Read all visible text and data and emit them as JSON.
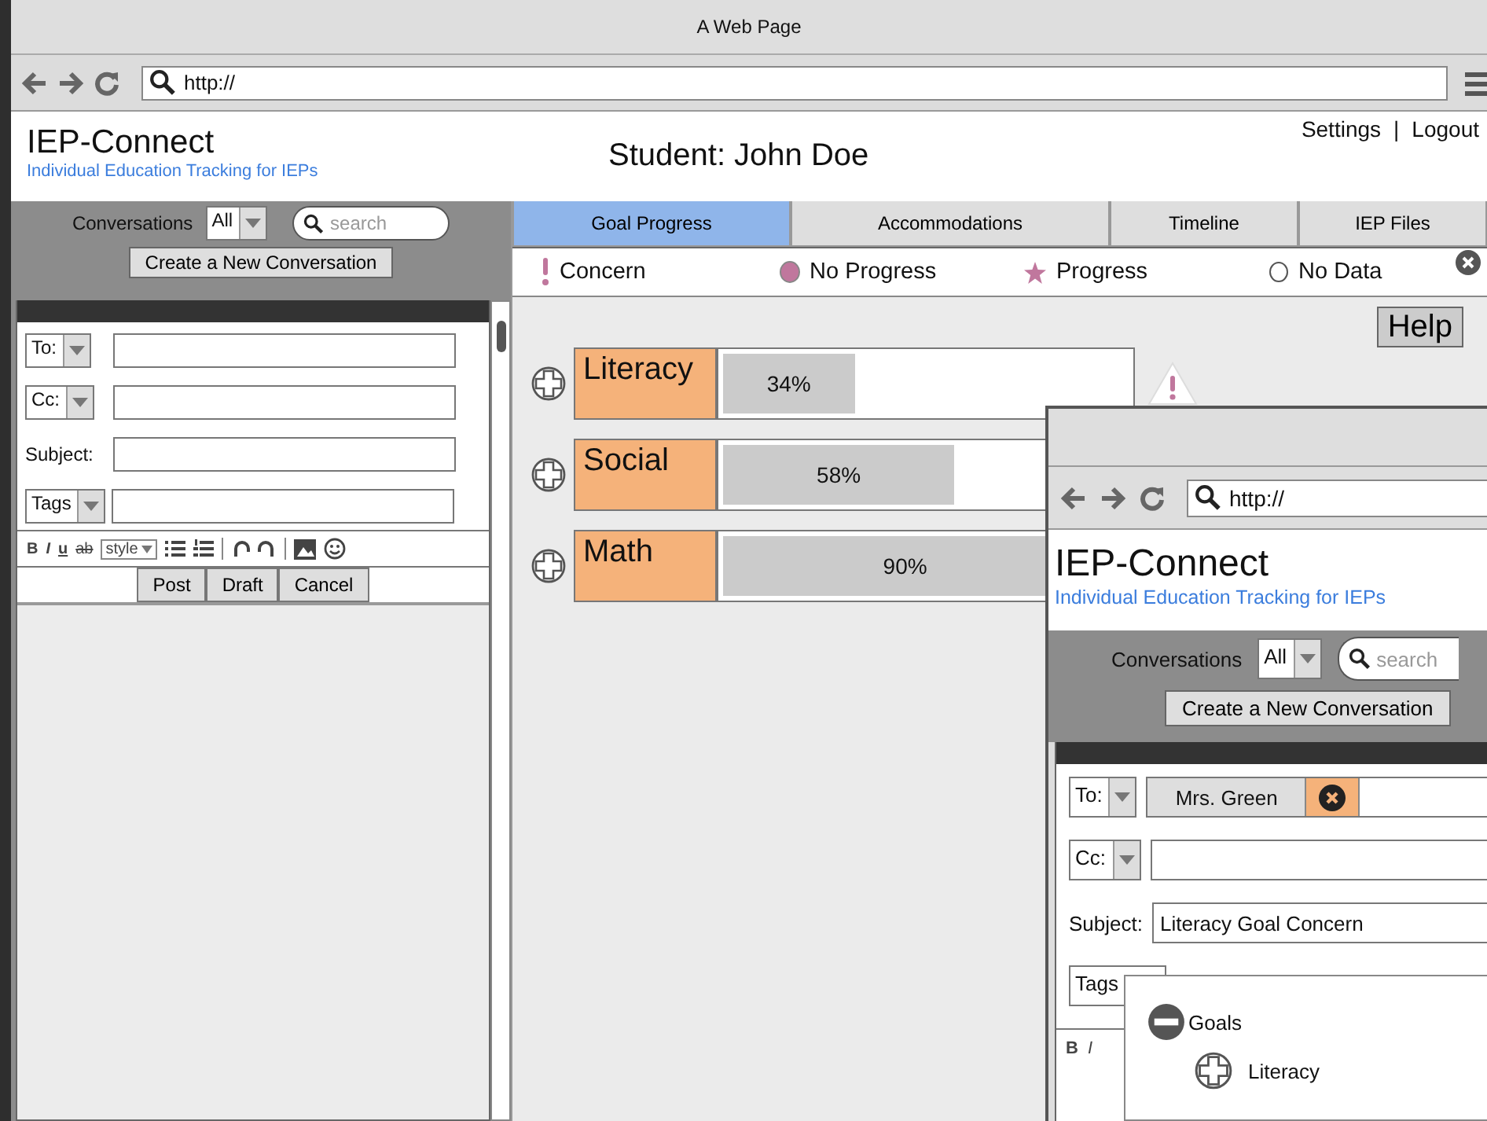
{
  "window": {
    "title": "A Web Page"
  },
  "address_bar": {
    "value": "http://"
  },
  "header": {
    "app_name": "IEP-Connect",
    "tagline": "Individual Education Tracking for IEPs",
    "student": "Student: John Doe",
    "links": [
      "Settings",
      "Logout"
    ],
    "separator": "|"
  },
  "sidebar": {
    "filter_label": "Conversations",
    "filter_value": "All",
    "search": {
      "placeholder": "search"
    },
    "create_button": "Create a New Conversation",
    "compose": {
      "to_label": "To:",
      "cc_label": "Cc:",
      "subject_label": "Subject:",
      "tags_label": "Tags",
      "format_buttons": [
        {
          "kind": "bold",
          "label": "B"
        },
        {
          "kind": "italic",
          "label": "I"
        },
        {
          "kind": "underline",
          "label": "u"
        },
        {
          "kind": "strike",
          "label": "ab"
        }
      ],
      "style_select": "style",
      "buttons": [
        "Post",
        "Draft",
        "Cancel"
      ]
    }
  },
  "tabs": [
    {
      "label": "Goal Progress",
      "selected": true
    },
    {
      "label": "Accommodations",
      "selected": false
    },
    {
      "label": "Timeline",
      "selected": false
    },
    {
      "label": "IEP Files",
      "selected": false
    }
  ],
  "legend": [
    {
      "kind": "concern",
      "label": "Concern"
    },
    {
      "kind": "no_progress",
      "label": "No Progress"
    },
    {
      "kind": "progress",
      "label": "Progress"
    },
    {
      "kind": "no_data",
      "label": "No Data"
    }
  ],
  "help_button": "Help",
  "goals": [
    {
      "name": "Literacy",
      "level": 0.34,
      "reading": "34%",
      "expanded": false,
      "concern": true
    },
    {
      "name": "Social",
      "level": 0.58,
      "reading": "58%",
      "expanded": false
    },
    {
      "name": "Math",
      "level": 0.9,
      "reading": "90%",
      "expanded": false
    }
  ],
  "popup_window": {
    "address": "http://",
    "app_name": "IEP-Connect",
    "tagline": "Individual Education Tracking for IEPs",
    "filter_label": "Conversations",
    "filter_value": "All",
    "search_placeholder": "search",
    "create_button": "Create a New Conversation",
    "to_label": "To:",
    "recipients": [
      {
        "name": "Mrs. Green"
      }
    ],
    "cc_label": "Cc:",
    "subject_label": "Subject:",
    "subject_value": "Literacy Goal Concern",
    "tags_label": "Tags",
    "format_buttons": [
      {
        "kind": "bold",
        "label": "B"
      },
      {
        "kind": "italic",
        "label": "I"
      }
    ],
    "tag_tree": [
      {
        "label": "Goals",
        "expanded": true,
        "children": [
          {
            "label": "Literacy",
            "expanded": false
          }
        ]
      }
    ]
  }
}
